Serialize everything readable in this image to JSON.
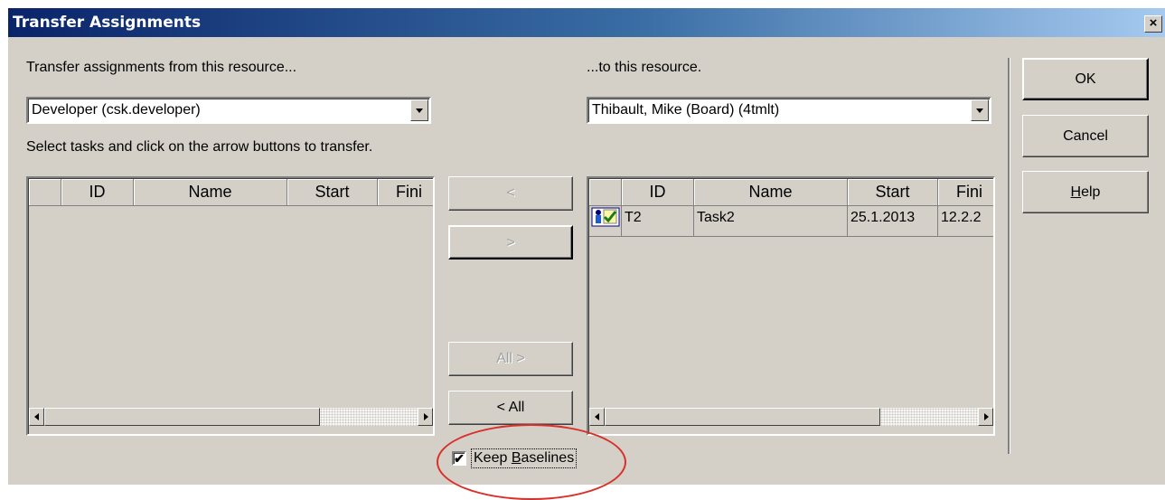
{
  "window": {
    "title": "Transfer Assignments",
    "close_glyph": "×"
  },
  "from": {
    "label": "Transfer assignments from this resource...",
    "selected": "Developer (csk.developer)"
  },
  "to": {
    "label": "...to this resource.",
    "selected": "Thibault, Mike (Board) (4tmlt)"
  },
  "instruction": "Select tasks and click on the arrow buttons to transfer.",
  "columns": [
    "",
    "ID",
    "Name",
    "Start",
    "Fini"
  ],
  "left_rows": [],
  "right_rows": [
    {
      "icon": "resource-task-icon",
      "id": "T2",
      "name": "Task2",
      "start": "25.1.2013",
      "finish": "12.2.2"
    }
  ],
  "arrows": {
    "move_left": "<",
    "move_right": ">",
    "all_right": "All >",
    "all_left": "< All"
  },
  "buttons": {
    "ok": "OK",
    "cancel": "Cancel",
    "help_prefix": "H",
    "help_rest": "elp"
  },
  "keep_baselines": {
    "prefix": "Keep ",
    "accel": "B",
    "rest": "aselines",
    "checked": true,
    "check_glyph": "✔"
  },
  "colors": {
    "face": "#d4d0c8",
    "title_from": "#0a246a",
    "title_to": "#a6caf0",
    "highlight_circle": "#d9302a"
  }
}
